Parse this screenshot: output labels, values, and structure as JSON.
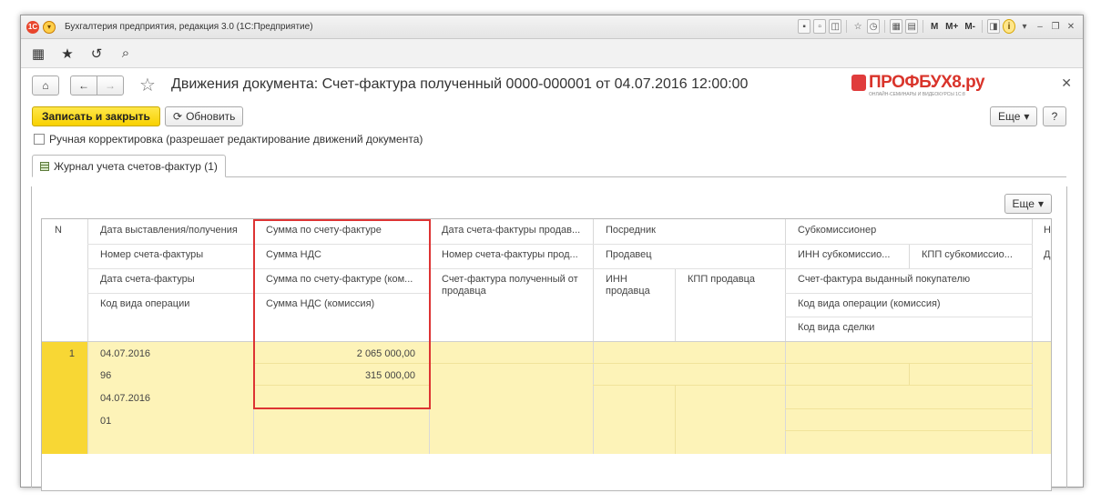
{
  "app": {
    "title": "Бухгалтерия предприятия, редакция 3.0 (1С:Предприятие)",
    "logo_text": "1С",
    "title_tools": [
      "M",
      "M+",
      "M-"
    ]
  },
  "document": {
    "title": "Движения документа: Счет-фактура полученный 0000-000001 от 04.07.2016 12:00:00"
  },
  "brand": {
    "name": "ПРОФБУХ8.ру",
    "tagline": "ОНЛАЙН-СЕМИНАРЫ И ВИДЕОКУРСЫ 1С:8"
  },
  "commands": {
    "save_close": "Записать и закрыть",
    "refresh": "Обновить",
    "more": "Еще",
    "help": "?"
  },
  "manual_correction": {
    "label": "Ручная корректировка (разрешает редактирование движений документа)",
    "checked": false
  },
  "tabs": [
    {
      "label": "Журнал учета счетов-фактур (1)"
    }
  ],
  "table": {
    "more": "Еще",
    "headers": {
      "n": "N",
      "c1": [
        "Дата выставления/получения",
        "Номер счета-фактуры",
        "Дата счета-фактуры",
        "Код вида операции"
      ],
      "c2": [
        "Сумма по счету-фактуре",
        "Сумма НДС",
        "Сумма по счету-фактуре (ком...",
        "Сумма НДС (комиссия)"
      ],
      "c3": [
        "Дата счета-фактуры продав...",
        "Номер счета-фактуры прод...",
        "Счет-фактура полученный от продавца"
      ],
      "c4": [
        "Посредник",
        "Продавец",
        "ИНН продавца",
        "КПП продавца"
      ],
      "c5": [
        "Субкомиссионер",
        "ИНН субкомиссио...",
        "КПП субкомиссио...",
        "Счет-фактура выданный покупателю",
        "Код вида операции (комиссия)",
        "Код вида сделки"
      ],
      "c6": [
        "Н",
        "Д"
      ]
    },
    "rows": [
      {
        "n": "1",
        "c1": [
          "04.07.2016",
          "96",
          "04.07.2016",
          "01"
        ],
        "c2": [
          "2 065 000,00",
          "315 000,00",
          "",
          ""
        ]
      }
    ]
  }
}
